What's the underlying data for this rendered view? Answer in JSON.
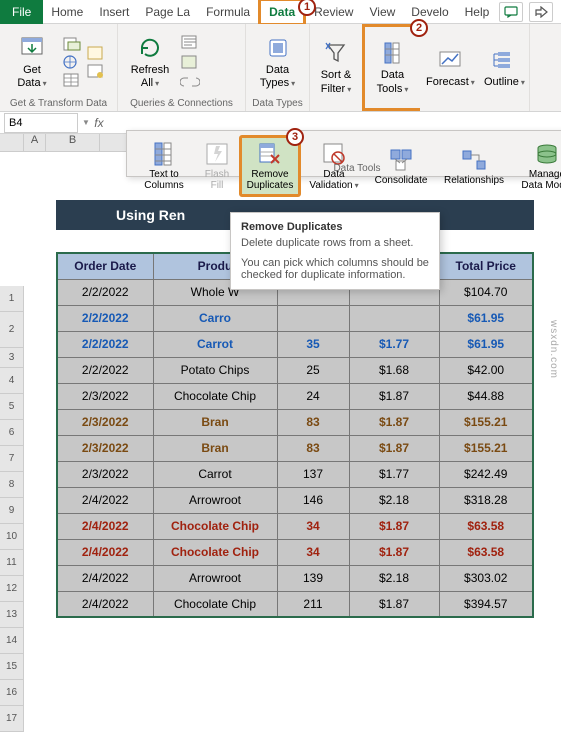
{
  "tabs": {
    "file": "File",
    "items": [
      "Home",
      "Insert",
      "Page La",
      "Formula",
      "Data",
      "Review",
      "View",
      "Develo",
      "Help"
    ],
    "active_index": 4
  },
  "callouts": {
    "c1": "1",
    "c2": "2",
    "c3": "3"
  },
  "ribbon": {
    "group1_label": "Get & Transform Data",
    "get_data": "Get\nData",
    "group2_label": "Queries & Connections",
    "refresh_all": "Refresh\nAll",
    "group3_label": "Data Types",
    "data_types": "Data\nTypes",
    "sort_filter": "Sort &\nFilter",
    "data_tools": "Data\nTools",
    "forecast": "Forecast",
    "outline": "Outline"
  },
  "popup": {
    "text_to_columns": "Text to\nColumns",
    "flash_fill": "Flash\nFill",
    "remove_duplicates": "Remove\nDuplicates",
    "data_validation": "Data\nValidation",
    "consolidate": "Consolidate",
    "relationships": "Relationships",
    "manage_data_model": "Manage\nData Model",
    "group_label": "Data Tools"
  },
  "tooltip": {
    "title": "Remove Duplicates",
    "sub": "Delete duplicate rows from a sheet.",
    "body": "You can pick which columns should be checked for duplicate information."
  },
  "namebox": "B4",
  "col_headers": [
    "A",
    "B"
  ],
  "title_band": "Using Ren",
  "table": {
    "headers": [
      "Order Date",
      "Produ",
      "",
      "",
      "Total Price"
    ],
    "rows": [
      {
        "style": "",
        "cells": [
          "2/2/2022",
          "Whole W",
          "",
          "",
          "$104.70"
        ]
      },
      {
        "style": "blue",
        "cells": [
          "2/2/2022",
          "Carro",
          "",
          "",
          "$61.95"
        ]
      },
      {
        "style": "blue",
        "cells": [
          "2/2/2022",
          "Carrot",
          "35",
          "$1.77",
          "$61.95"
        ]
      },
      {
        "style": "",
        "cells": [
          "2/2/2022",
          "Potato Chips",
          "25",
          "$1.68",
          "$42.00"
        ]
      },
      {
        "style": "",
        "cells": [
          "2/3/2022",
          "Chocolate Chip",
          "24",
          "$1.87",
          "$44.88"
        ]
      },
      {
        "style": "brown",
        "cells": [
          "2/3/2022",
          "Bran",
          "83",
          "$1.87",
          "$155.21"
        ]
      },
      {
        "style": "brown",
        "cells": [
          "2/3/2022",
          "Bran",
          "83",
          "$1.87",
          "$155.21"
        ]
      },
      {
        "style": "",
        "cells": [
          "2/3/2022",
          "Carrot",
          "137",
          "$1.77",
          "$242.49"
        ]
      },
      {
        "style": "",
        "cells": [
          "2/4/2022",
          "Arrowroot",
          "146",
          "$2.18",
          "$318.28"
        ]
      },
      {
        "style": "red",
        "cells": [
          "2/4/2022",
          "Chocolate Chip",
          "34",
          "$1.87",
          "$63.58"
        ]
      },
      {
        "style": "red",
        "cells": [
          "2/4/2022",
          "Chocolate Chip",
          "34",
          "$1.87",
          "$63.58"
        ]
      },
      {
        "style": "",
        "cells": [
          "2/4/2022",
          "Arrowroot",
          "139",
          "$2.18",
          "$303.02"
        ]
      },
      {
        "style": "",
        "cells": [
          "2/4/2022",
          "Chocolate Chip",
          "211",
          "$1.87",
          "$394.57"
        ]
      }
    ]
  },
  "row_numbers": [
    "1",
    "2",
    "3",
    "4",
    "5",
    "6",
    "7",
    "8",
    "9",
    "10",
    "11",
    "12",
    "13",
    "14",
    "15",
    "16",
    "17"
  ],
  "watermark": "wsxdn.com"
}
